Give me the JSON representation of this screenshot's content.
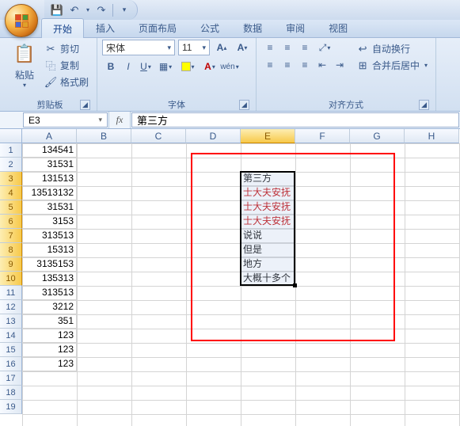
{
  "qat": {
    "save": "💾",
    "undo": "↶",
    "redo": "↷"
  },
  "tabs": [
    "开始",
    "插入",
    "页面布局",
    "公式",
    "数据",
    "审阅",
    "视图"
  ],
  "active_tab": 0,
  "ribbon": {
    "clipboard": {
      "paste": "粘贴",
      "cut": "剪切",
      "copy": "复制",
      "format_painter": "格式刷",
      "label": "剪贴板"
    },
    "font": {
      "name": "宋体",
      "size": "11",
      "label": "字体"
    },
    "align": {
      "wrap": "自动换行",
      "merge": "合并后居中",
      "label": "对齐方式"
    }
  },
  "namebox": "E3",
  "formula": "第三方",
  "columns": [
    "A",
    "B",
    "C",
    "D",
    "E",
    "F",
    "G",
    "H"
  ],
  "rows": 19,
  "col_a": [
    "134541",
    "31531",
    "131513",
    "13513132",
    "31531",
    "3153",
    "313513",
    "15313",
    "3135153",
    "135313",
    "313513",
    "3212",
    "351",
    "123",
    "123",
    "123"
  ],
  "col_e": [
    {
      "t": "第三方",
      "r": false
    },
    {
      "t": "士大夫安抚",
      "r": true
    },
    {
      "t": "士大夫安抚",
      "r": true
    },
    {
      "t": "士大夫安抚",
      "r": true
    },
    {
      "t": "说说",
      "r": false
    },
    {
      "t": "但是",
      "r": false
    },
    {
      "t": "地方",
      "r": false
    },
    {
      "t": "大概十多个",
      "r": false
    }
  ],
  "chart_data": null
}
